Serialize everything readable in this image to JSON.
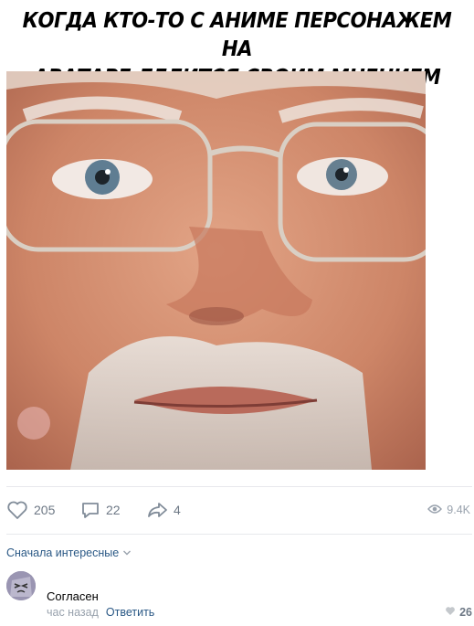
{
  "post": {
    "meme_caption_line1": "КОГДА КТО-ТО С АНИМЕ ПЕРСОНАЖЕМ НА",
    "meme_caption_line2": "АВАТАРЕ ДЕЛИТСЯ СВОИМ МНЕНИЕМ",
    "likes": "205",
    "comments": "22",
    "shares": "4",
    "views": "9.4K"
  },
  "comments_section": {
    "sort_label": "Сначала интересные",
    "items": [
      {
        "text": "Согласен",
        "time": "час назад",
        "reply_label": "Ответить",
        "likes": "26"
      }
    ]
  },
  "colors": {
    "link": "#2a5885",
    "icon": "#818c99",
    "muted": "#99a2ad",
    "divider": "#e7e8ec"
  },
  "icons": [
    "heart-icon",
    "comment-icon",
    "share-icon",
    "eye-icon",
    "chevron-down-icon",
    "small-heart-icon"
  ]
}
